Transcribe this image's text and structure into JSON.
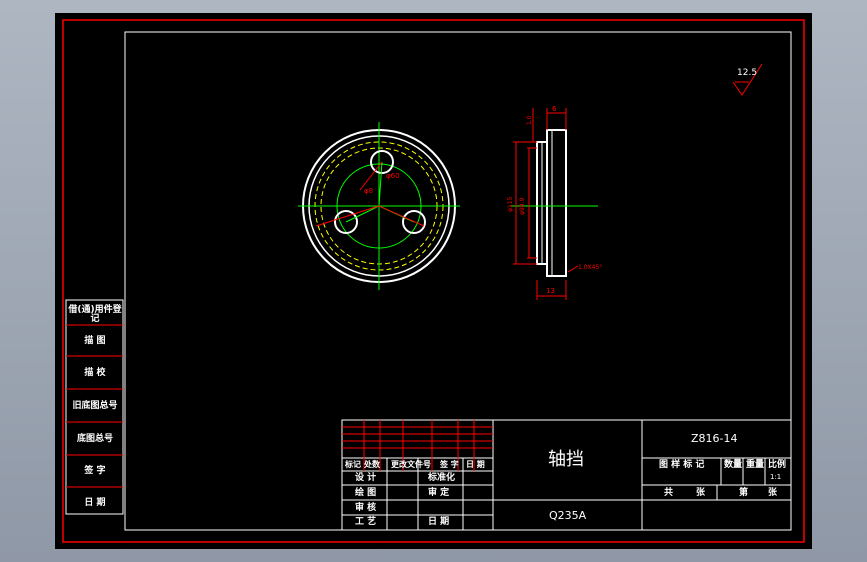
{
  "colors": {
    "background": "#000000",
    "frame": "#ff0000",
    "part_outline": "#ffffff",
    "center_line": "#00ff00",
    "hidden_line": "#ffff00",
    "dimension": "#ff0000",
    "desktop": "#9aa2ae"
  },
  "roughness": "12.5",
  "dimensions": {
    "top_width": "6",
    "height_small": "13",
    "left_small": "1.0",
    "outer_diameter": "φ115",
    "inner_diameter": "φ98.9",
    "chamfer": "1.0X45°",
    "hole_circle": "φ60",
    "hole_dia": "φ8"
  },
  "side_panel": [
    "借(通)用件登记",
    "描 图",
    "描 校",
    "旧底图总号",
    "底图总号",
    "签 字",
    "日 期"
  ],
  "title_block": {
    "part_name": "轴挡",
    "material": "Q235A",
    "drawing_number": "Z816-14",
    "scale_headers": [
      "图 样 标 记",
      "数量",
      "重量",
      "比例"
    ],
    "scale_value": "1:1",
    "sheets": [
      "共",
      "张",
      "第",
      "张"
    ],
    "revision_headers": [
      "标记",
      "处数",
      "更改文件号",
      "签 字",
      "日 期"
    ],
    "sign_rows_left": [
      "设 计",
      "绘 图",
      "审 核",
      "工 艺"
    ],
    "sign_rows_right": [
      "标准化",
      "审 定",
      "日 期"
    ]
  }
}
